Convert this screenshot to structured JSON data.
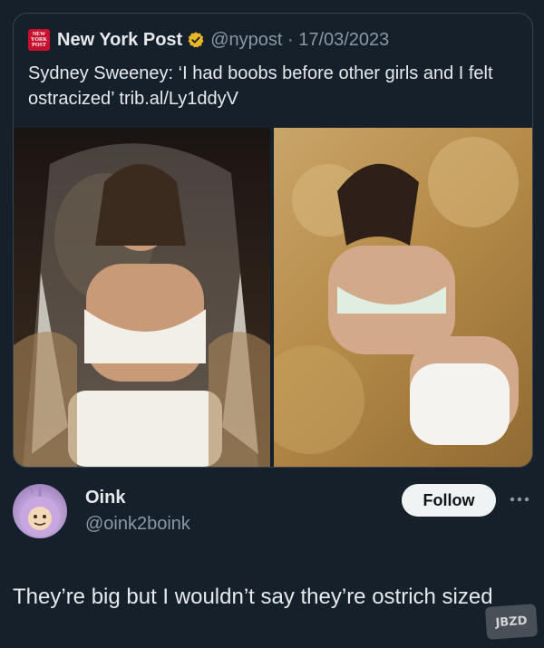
{
  "quoted_post": {
    "author_name": "New York Post",
    "logo_text": "NEW YORK POST",
    "handle_date": "@nypost · 17/03/2023",
    "text": "Sydney Sweeney: ‘I had boobs before other girls and I felt ostracized’ trib.al/Ly1ddyV",
    "images": [
      "photo-left",
      "photo-right"
    ],
    "icons": [
      "verified-badge-icon"
    ]
  },
  "reply": {
    "name": "Oink",
    "handle": "@oink2boink",
    "follow_label": "Follow",
    "text": "They’re big but I wouldn’t say they’re ostrich sized",
    "icons": [
      "avatar",
      "more-options-icon"
    ]
  },
  "watermark": {
    "text": "JBZD"
  },
  "colors": {
    "background": "#15202b",
    "border": "#38444d",
    "secondary_text": "#8b98a5",
    "verified_gold": "#e8b829",
    "logo_red": "#c8102e"
  }
}
